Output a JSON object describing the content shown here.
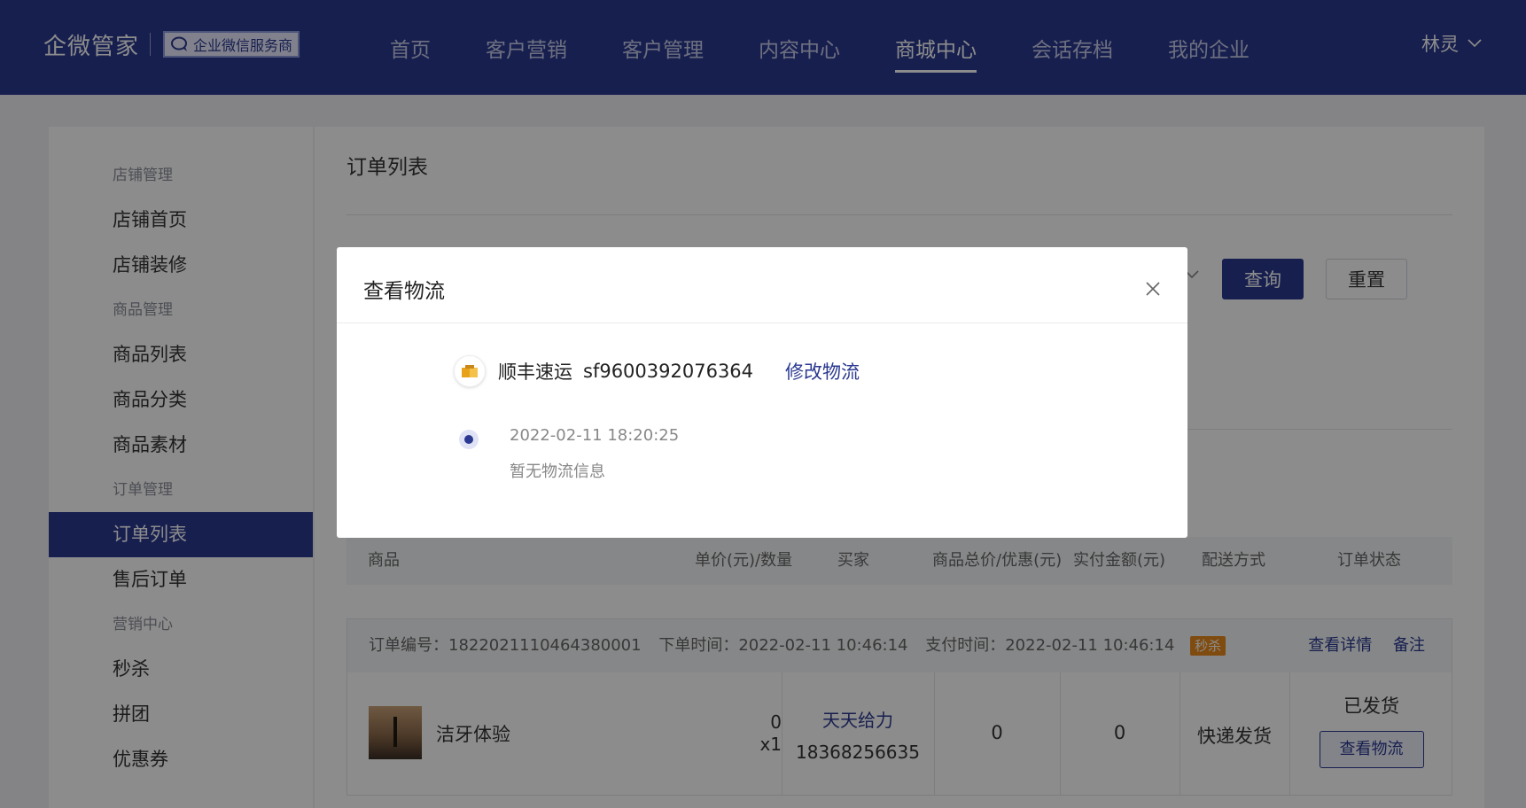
{
  "header": {
    "brand": "企微管家",
    "badge": "企业微信服务商",
    "nav": [
      {
        "label": "首页"
      },
      {
        "label": "客户营销"
      },
      {
        "label": "客户管理"
      },
      {
        "label": "内容中心"
      },
      {
        "label": "商城中心",
        "active": true
      },
      {
        "label": "会话存档"
      },
      {
        "label": "我的企业"
      }
    ],
    "user": "林灵"
  },
  "sidebar": {
    "groups": [
      {
        "title": "店铺管理",
        "items": [
          "店铺首页",
          "店铺装修"
        ]
      },
      {
        "title": "商品管理",
        "items": [
          "商品列表",
          "商品分类",
          "商品素材"
        ]
      },
      {
        "title": "订单管理",
        "items": [
          "订单列表",
          "售后订单"
        ]
      },
      {
        "title": "营销中心",
        "items": [
          "秒杀",
          "拼团",
          "优惠券"
        ]
      }
    ],
    "active_item": "订单列表"
  },
  "main": {
    "title": "订单列表",
    "query_label": "查询",
    "reset_label": "重置",
    "table_headers": [
      "商品",
      "单价(元)/数量",
      "买家",
      "商品总价/优惠(元)",
      "实付金额(元)",
      "配送方式",
      "订单状态"
    ],
    "order": {
      "number_label": "订单编号：1822021110464380001",
      "order_time": "下单时间：2022-02-11 10:46:14",
      "pay_time": "支付时间：2022-02-11 10:46:14",
      "tag": "秒杀",
      "detail_link": "查看详情",
      "remark_link": "备注",
      "product_name": "洁牙体验",
      "unit_price": "0",
      "quantity": "x1",
      "buyer_nick": "天天给力",
      "buyer_phone": "18368256635",
      "total": "0",
      "paid": "0",
      "delivery": "快递发货",
      "status": "已发货",
      "logistics_button": "查看物流"
    }
  },
  "modal": {
    "title": "查看物流",
    "carrier": "顺丰速运",
    "tracking_no": "sf9600392076364",
    "edit_link": "修改物流",
    "track_time": "2022-02-11 18:20:25",
    "track_msg": "暂无物流信息"
  },
  "colors": {
    "primary": "#2b3990",
    "tag_orange": "#e8891a"
  }
}
